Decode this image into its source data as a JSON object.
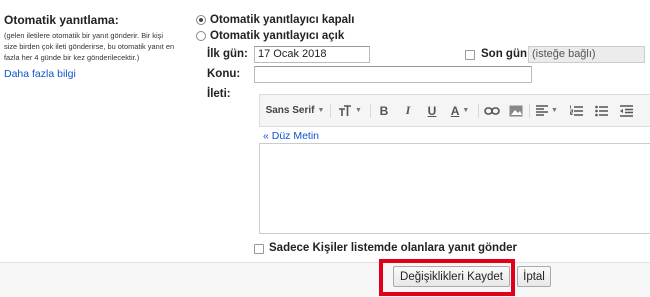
{
  "vacation": {
    "title": "Otomatik yanıtlama:",
    "description": "(gelen iletilere otomatik bir yanıt gönderir. Bir kişi size birden çok ileti gönderirse, bu otomatik yanıt en fazla her 4 günde bir kez gönderilecektir.)",
    "learn_more": "Daha fazla bilgi",
    "radio_off_label": "Otomatik yanıtlayıcı kapalı",
    "radio_on_label": "Otomatik yanıtlayıcı açık",
    "selected": "off"
  },
  "fields": {
    "first_day_label": "İlk gün:",
    "first_day_value": "17 Ocak 2018",
    "last_day_label": "Son gün:",
    "last_day_value": "(isteğe bağlı)",
    "last_day_checked": false,
    "subject_label": "Konu:",
    "subject_value": "",
    "message_label": "İleti:"
  },
  "toolbar": {
    "font_label": "Sans Serif",
    "font_size_icon": "font-size-icon",
    "bold": "B",
    "italic": "I",
    "underline": "U",
    "text_color": "A",
    "icons": [
      "link-icon",
      "image-icon",
      "align-icon",
      "numbered-list-icon",
      "bulleted-list-icon",
      "indent-less-icon"
    ]
  },
  "editor": {
    "plain_text_link": "« Düz Metin",
    "body": ""
  },
  "contacts_only": {
    "label": "Sadece Kişiler listemde olanlara yanıt gönder",
    "checked": false
  },
  "actions": {
    "save_label": "Değişiklikleri Kaydet",
    "cancel_label": "İptal",
    "highlight_color": "#e0001a"
  }
}
